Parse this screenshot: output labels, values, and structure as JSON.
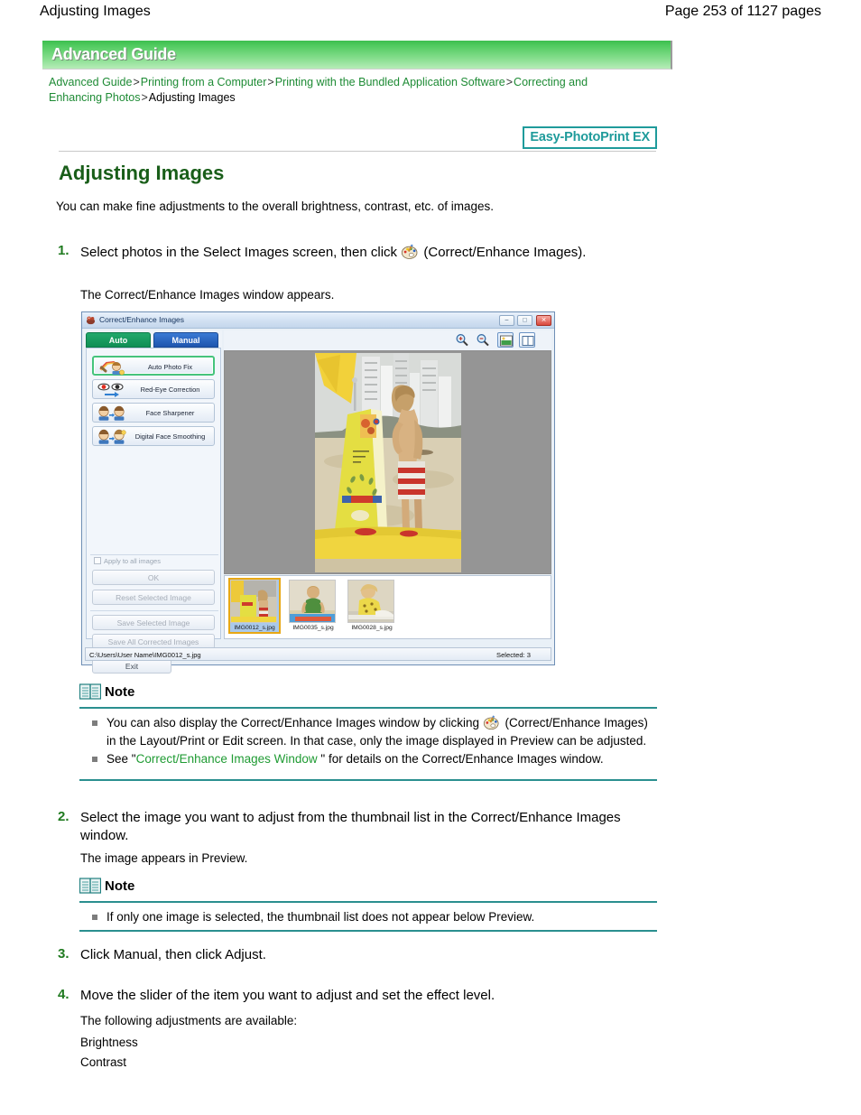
{
  "page": {
    "header_title": "Adjusting Images",
    "page_number_text": "Page 253 of 1127 pages"
  },
  "banner": {
    "label": "Advanced Guide"
  },
  "breadcrumb": {
    "items": [
      {
        "label": "Advanced Guide",
        "link": true
      },
      {
        "label": "Printing from a Computer",
        "link": true
      },
      {
        "label": "Printing with the Bundled Application Software",
        "link": true
      },
      {
        "label": "Correcting and Enhancing Photos",
        "link": true
      },
      {
        "label": "Adjusting Images",
        "link": false
      }
    ],
    "separator": ">"
  },
  "badge": {
    "label": "Easy-PhotoPrint EX",
    "color": "#1f9b9b"
  },
  "content": {
    "title": "Adjusting Images",
    "title_color": "#195e19",
    "intro": "You can make fine adjustments to the overall brightness, contrast, etc. of images.",
    "steps": [
      {
        "number": "1.",
        "text_before_icon": "Select photos in the Select Images screen, then click",
        "icon": "palette-icon",
        "text_after_icon": "(Correct/Enhance Images).",
        "result": "The Correct/Enhance Images window appears."
      },
      {
        "number": "2.",
        "text": "Select the image you want to adjust from the thumbnail list in the Correct/Enhance Images window.",
        "result": "The image appears in Preview."
      },
      {
        "number": "3.",
        "text": "Click Manual, then click Adjust."
      },
      {
        "number": "4.",
        "text": "Move the slider of the item you want to adjust and set the effect level.",
        "result": "The following adjustments are available:",
        "list": [
          "Brightness",
          "Contrast"
        ]
      }
    ]
  },
  "notes": [
    {
      "title": "Note",
      "items": [
        {
          "part1": "You can also display the Correct/Enhance Images window by clicking",
          "icon": "palette-icon",
          "part2": "(Correct/Enhance Images) in the Layout/Print or Edit screen. In that case, only the image displayed in Preview can be adjusted."
        },
        {
          "prefix": "See \"",
          "link": "Correct/Enhance Images Window",
          "suffix": " \" for details on the Correct/Enhance Images window."
        }
      ]
    },
    {
      "title": "Note",
      "items": [
        {
          "text": "If only one image is selected, the thumbnail list does not appear below Preview."
        }
      ]
    }
  ],
  "app_window": {
    "title": "Correct/Enhance Images",
    "window_buttons": [
      {
        "name": "minimize",
        "glyph": "–"
      },
      {
        "name": "maximize",
        "glyph": "□"
      },
      {
        "name": "close",
        "glyph": "✕"
      }
    ],
    "tabs": [
      {
        "label": "Auto",
        "active": true
      },
      {
        "label": "Manual",
        "active": false
      }
    ],
    "effect_buttons": [
      {
        "label": "Auto Photo Fix",
        "selected": true
      },
      {
        "label": "Red-Eye Correction",
        "selected": false
      },
      {
        "label": "Face Sharpener",
        "selected": false
      },
      {
        "label": "Digital Face Smoothing",
        "selected": false
      }
    ],
    "apply_all_label": "Apply to all images",
    "action_buttons": [
      {
        "label": "OK"
      },
      {
        "label": "Reset Selected Image"
      },
      {
        "label": "Save Selected Image"
      },
      {
        "label": "Save All Corrected Images"
      }
    ],
    "exit_label": "Exit",
    "toolbar_icons": [
      {
        "name": "zoom-in-icon"
      },
      {
        "name": "zoom-out-icon"
      },
      {
        "name": "fit-to-window-icon",
        "active": true
      },
      {
        "name": "compare-view-icon",
        "active": false
      }
    ],
    "thumbnails": [
      {
        "label": "IMG0012_s.jpg",
        "selected": true
      },
      {
        "label": "IMG0035_s.jpg",
        "selected": false
      },
      {
        "label": "IMG0028_s.jpg",
        "selected": false
      }
    ],
    "statusbar": {
      "path": "C:\\Users\\User Name\\IMG0012_s.jpg",
      "selected_count": "Selected: 3"
    }
  }
}
